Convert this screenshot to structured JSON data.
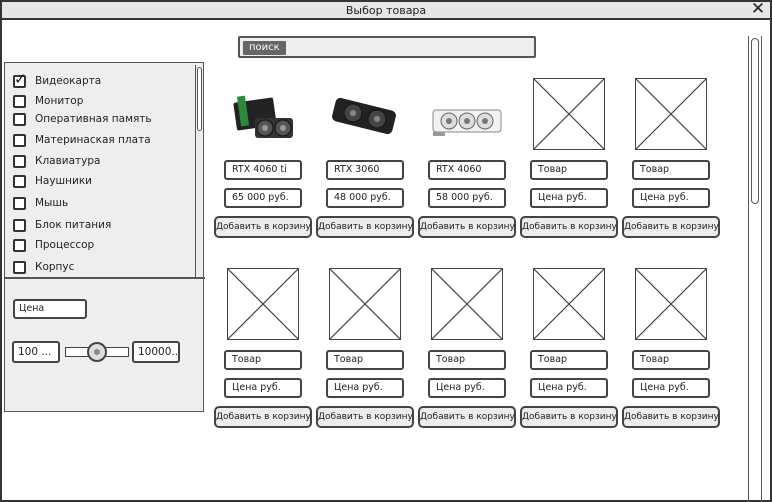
{
  "window": {
    "title": "Выбор товара",
    "close_symbol": "✕"
  },
  "search": {
    "label": "поиск"
  },
  "categories": [
    {
      "label": "Видеокарта",
      "checked": true
    },
    {
      "label": "Монитор",
      "checked": false
    },
    {
      "label": "Оперативная память",
      "checked": false
    },
    {
      "label": "Материнаская плата",
      "checked": false
    },
    {
      "label": "Клавиатура",
      "checked": false
    },
    {
      "label": "Наушники",
      "checked": false
    },
    {
      "label": "Мышь",
      "checked": false
    },
    {
      "label": "Блок питания",
      "checked": false
    },
    {
      "label": "Процессор",
      "checked": false
    },
    {
      "label": "Корпус",
      "checked": false
    }
  ],
  "price_filter": {
    "label": "Цена",
    "min": "100 ...",
    "max": "10000..."
  },
  "products": [
    {
      "name": "RTX 4060 ti",
      "price": "65 000 руб.",
      "button": "Добавить в корзину",
      "image": "gpu-image"
    },
    {
      "name": "RTX 3060",
      "price": "48 000 руб.",
      "button": "Добавить в корзину",
      "image": "gpu-image"
    },
    {
      "name": "RTX 4060",
      "price": "58 000 руб.",
      "button": "Добавить в корзину",
      "image": "gpu-image"
    },
    {
      "name": "Товар",
      "price": "Цена руб.",
      "button": "Добавить в корзину",
      "image": "placeholder-image"
    },
    {
      "name": "Товар",
      "price": "Цена руб.",
      "button": "Добавить в корзину",
      "image": "placeholder-image"
    },
    {
      "name": "Товар",
      "price": "Цена руб.",
      "button": "Добавить в корзину",
      "image": "placeholder-image"
    },
    {
      "name": "Товар",
      "price": "Цена руб.",
      "button": "Добавить в корзину",
      "image": "placeholder-image"
    },
    {
      "name": "Товар",
      "price": "Цена руб.",
      "button": "Добавить в корзину",
      "image": "placeholder-image"
    },
    {
      "name": "Товар",
      "price": "Цена руб.",
      "button": "Добавить в корзину",
      "image": "placeholder-image"
    },
    {
      "name": "Товар",
      "price": "Цена руб.",
      "button": "Добавить в корзину",
      "image": "placeholder-image"
    }
  ]
}
